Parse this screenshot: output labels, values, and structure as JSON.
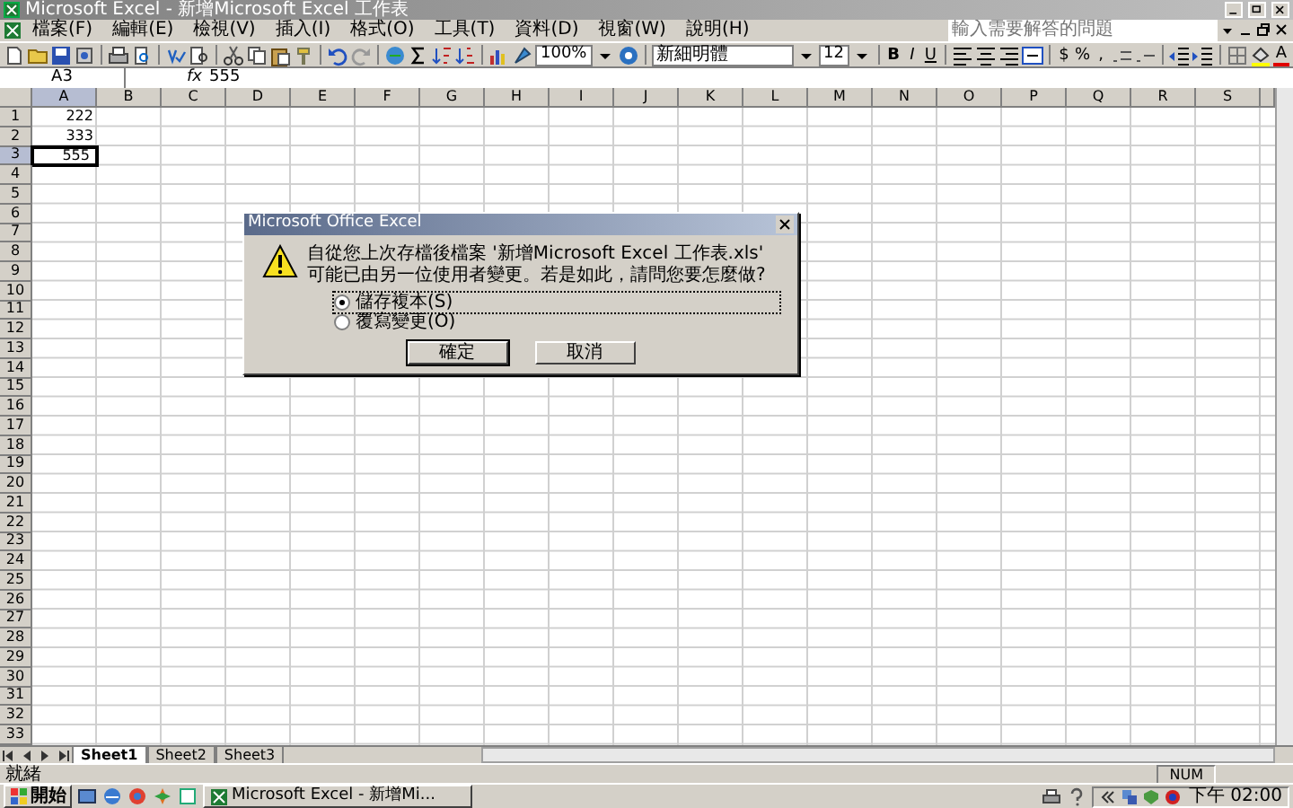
{
  "window": {
    "title": "Microsoft Excel - 新增Microsoft Excel 工作表"
  },
  "menu": [
    {
      "label": "檔案(F)"
    },
    {
      "label": "編輯(E)"
    },
    {
      "label": "檢視(V)"
    },
    {
      "label": "插入(I)"
    },
    {
      "label": "格式(O)"
    },
    {
      "label": "工具(T)"
    },
    {
      "label": "資料(D)"
    },
    {
      "label": "視窗(W)"
    },
    {
      "label": "說明(H)"
    }
  ],
  "help_search": {
    "placeholder": "輸入需要解答的問題"
  },
  "toolbar": {
    "zoom": "100%",
    "font": "新細明體",
    "font_size": "12",
    "format_buttons": [
      "B",
      "I",
      "U"
    ],
    "number_buttons": [
      "$",
      "%",
      ","
    ],
    "font_color": "A"
  },
  "formula_bar": {
    "name_box": "A3",
    "fx": "fx",
    "value": "555"
  },
  "sheet": {
    "columns": [
      {
        "label": "A",
        "selected": true
      },
      {
        "label": "B",
        "selected": false
      },
      {
        "label": "C",
        "selected": false
      },
      {
        "label": "D",
        "selected": false
      },
      {
        "label": "E",
        "selected": false
      },
      {
        "label": "F",
        "selected": false
      },
      {
        "label": "G",
        "selected": false
      },
      {
        "label": "H",
        "selected": false
      },
      {
        "label": "I",
        "selected": false
      },
      {
        "label": "J",
        "selected": false
      },
      {
        "label": "K",
        "selected": false
      },
      {
        "label": "L",
        "selected": false
      },
      {
        "label": "M",
        "selected": false
      },
      {
        "label": "N",
        "selected": false
      },
      {
        "label": "O",
        "selected": false
      },
      {
        "label": "P",
        "selected": false
      },
      {
        "label": "Q",
        "selected": false
      },
      {
        "label": "R",
        "selected": false
      },
      {
        "label": "S",
        "selected": false
      }
    ],
    "rows": [
      {
        "label": "1",
        "selected": false,
        "cells": [
          "222"
        ]
      },
      {
        "label": "2",
        "selected": false,
        "cells": [
          "333"
        ]
      },
      {
        "label": "3",
        "selected": true,
        "cells": [
          "555"
        ]
      },
      {
        "label": "4",
        "selected": false
      },
      {
        "label": "5",
        "selected": false
      },
      {
        "label": "6",
        "selected": false
      },
      {
        "label": "7",
        "selected": false
      },
      {
        "label": "8",
        "selected": false
      },
      {
        "label": "9",
        "selected": false
      },
      {
        "label": "10",
        "selected": false
      },
      {
        "label": "11",
        "selected": false
      },
      {
        "label": "12",
        "selected": false
      },
      {
        "label": "13",
        "selected": false
      },
      {
        "label": "14",
        "selected": false
      },
      {
        "label": "15",
        "selected": false
      },
      {
        "label": "16",
        "selected": false
      },
      {
        "label": "17",
        "selected": false
      },
      {
        "label": "18",
        "selected": false
      },
      {
        "label": "19",
        "selected": false
      },
      {
        "label": "20",
        "selected": false
      },
      {
        "label": "21",
        "selected": false
      },
      {
        "label": "22",
        "selected": false
      },
      {
        "label": "23",
        "selected": false
      },
      {
        "label": "24",
        "selected": false
      },
      {
        "label": "25",
        "selected": false
      },
      {
        "label": "26",
        "selected": false
      },
      {
        "label": "27",
        "selected": false
      },
      {
        "label": "28",
        "selected": false
      },
      {
        "label": "29",
        "selected": false
      },
      {
        "label": "30",
        "selected": false
      },
      {
        "label": "31",
        "selected": false
      },
      {
        "label": "32",
        "selected": false
      },
      {
        "label": "33",
        "selected": false
      }
    ]
  },
  "dialog": {
    "title": "Microsoft Office Excel",
    "message": "自從您上次存檔後檔案 '新增Microsoft Excel 工作表.xls' 可能已由另一位使用者變更。若是如此，請問您要怎麼做?",
    "options": [
      {
        "label": "儲存複本(S)",
        "selected": true
      },
      {
        "label": "覆寫變更(O)",
        "selected": false
      }
    ],
    "buttons": [
      {
        "label": "確定",
        "default": true
      },
      {
        "label": "取消",
        "default": false
      }
    ]
  },
  "sheet_tabs": [
    {
      "label": "Sheet1",
      "selected": true
    },
    {
      "label": "Sheet2",
      "selected": false
    },
    {
      "label": "Sheet3",
      "selected": false
    }
  ],
  "status_bar": {
    "text": "就緒",
    "indicator": "NUM"
  },
  "taskbar": {
    "start": "開始",
    "windows": [
      {
        "label": "Microsoft Excel - 新增Mi...",
        "active": false
      }
    ],
    "clock": "下午 02:00"
  }
}
